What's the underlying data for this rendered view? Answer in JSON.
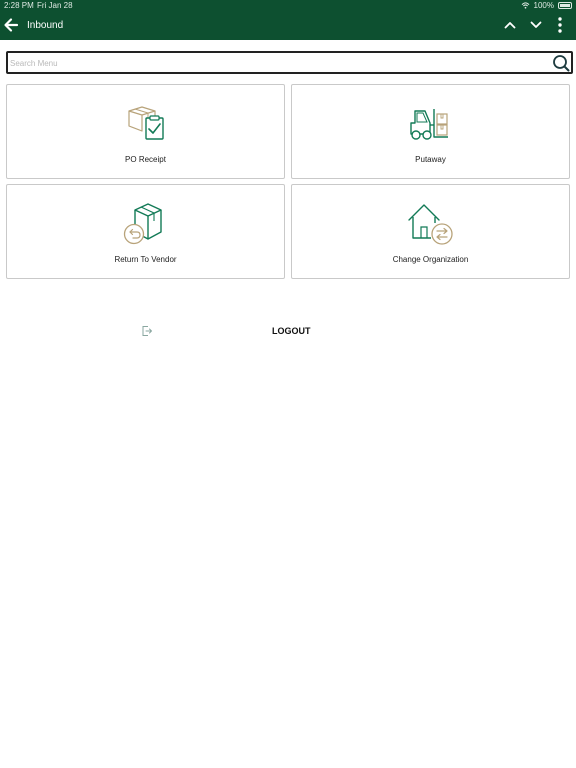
{
  "status_bar": {
    "time": "2:28 PM",
    "date": "Fri Jan 28",
    "battery": "100%"
  },
  "header": {
    "title": "Inbound"
  },
  "search": {
    "placeholder": "Search Menu"
  },
  "tiles": [
    {
      "label": "PO Receipt"
    },
    {
      "label": "Putaway"
    },
    {
      "label": "Return To Vendor"
    },
    {
      "label": "Change Organization"
    }
  ],
  "logout": {
    "label": "LOGOUT"
  },
  "colors": {
    "header_bg": "#0d5030",
    "icon_green": "#127a56",
    "icon_gold": "#b8a37a"
  },
  "icons": {
    "back": "arrow-left-icon",
    "up": "chevron-up-icon",
    "down": "chevron-down-icon",
    "more": "more-vertical-icon",
    "search": "search-icon",
    "po_receipt": "box-clipboard-check-icon",
    "putaway": "forklift-icon",
    "return": "box-return-icon",
    "change_org": "house-swap-icon",
    "logout": "logout-icon"
  }
}
